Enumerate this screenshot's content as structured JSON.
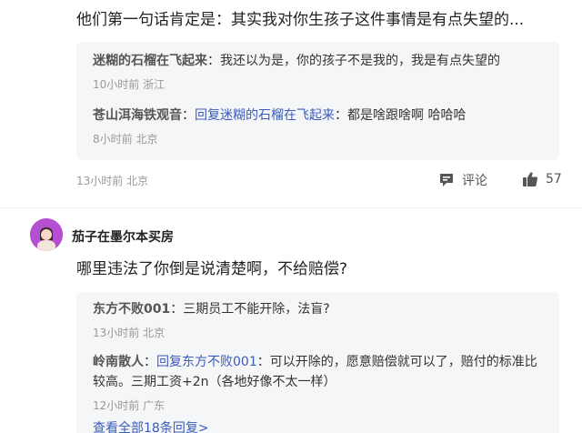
{
  "comment1": {
    "text": "他们第一句话肯定是：其实我对你生孩子这件事情是有点失望的...",
    "replies": [
      {
        "user": "迷糊的石榴在飞起来",
        "sep": "：",
        "text": "我还以为是，你的孩子不是我的，我是有点失望的",
        "meta": "10小时前 浙江"
      },
      {
        "user": "苍山洱海铁观音",
        "sep": "：",
        "reply_prefix": "回复迷糊的石榴在飞起来",
        "sep2": "：",
        "text": "都是啥跟啥啊 哈哈哈",
        "meta": "8小时前 北京"
      }
    ],
    "meta": "13小时前 北京",
    "comment_label": "评论",
    "like_count": "57"
  },
  "comment2": {
    "user": "茄子在墨尔本买房",
    "text": "哪里违法了你倒是说清楚啊，不给赔偿?",
    "replies": [
      {
        "user": "东方不败001",
        "sep": "：",
        "text": "三期员工不能开除，法盲?",
        "meta": "13小时前 北京"
      },
      {
        "user": "岭南散人",
        "sep": "：",
        "reply_prefix": "回复东方不败001",
        "sep2": "：",
        "text": "可以开除的，愿意赔偿就可以了，赔付的标准比较高。三期工资+2n（各地好像不太一样）",
        "meta": "12小时前 广东"
      }
    ],
    "view_all": "查看全部18条回复>"
  },
  "icons": {
    "comment": "comment-icon",
    "like": "thumbs-up-icon"
  },
  "colors": {
    "link": "#3b5bbd",
    "reply_bg": "#f5f6f7",
    "meta": "#999999"
  }
}
